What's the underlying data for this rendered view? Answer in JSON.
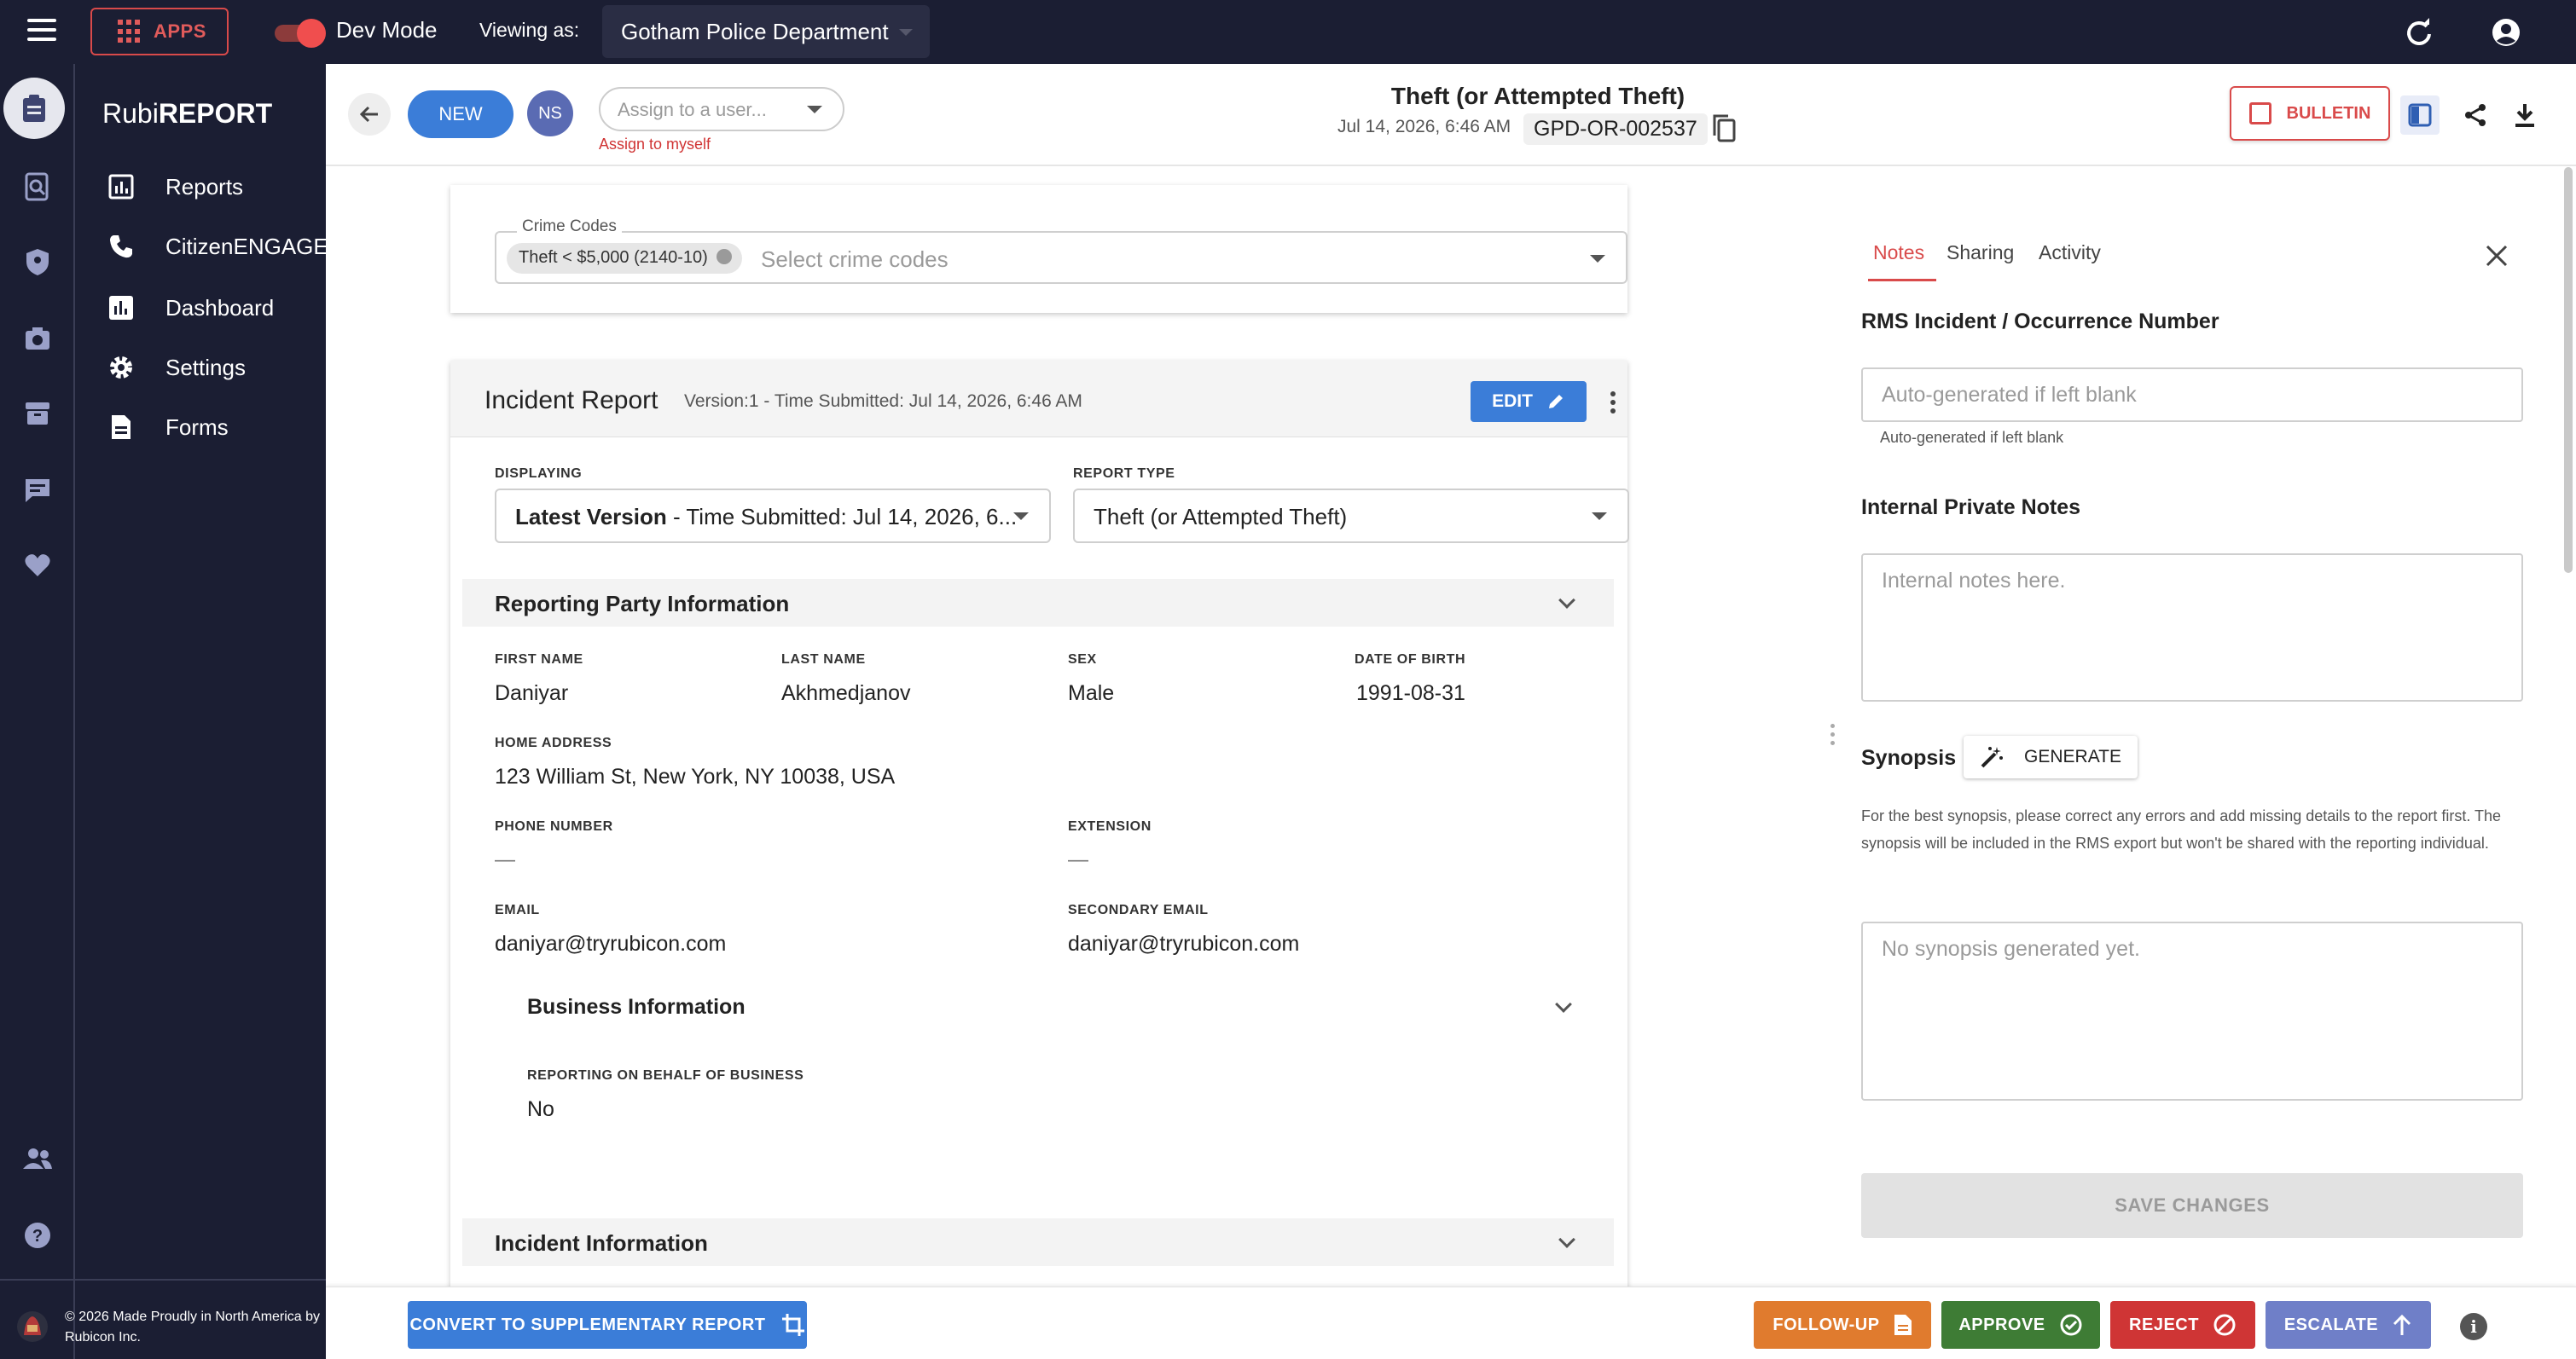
{
  "topbar": {
    "apps_label": "APPS",
    "dev_mode_label": "Dev Mode",
    "viewing_as_label": "Viewing as:",
    "department": "Gotham Police Department"
  },
  "brand": {
    "prefix": "Rubi",
    "suffix": "REPORT"
  },
  "nav": {
    "items": [
      {
        "label": "Reports",
        "icon": "reports-icon"
      },
      {
        "label": "CitizenENGAGE",
        "icon": "phone-icon"
      },
      {
        "label": "Dashboard",
        "icon": "dashboard-icon"
      },
      {
        "label": "Settings",
        "icon": "gear-icon"
      },
      {
        "label": "Forms",
        "icon": "document-icon"
      }
    ],
    "footer": "© 2026 Made Proudly in North America by Rubicon Inc."
  },
  "header": {
    "new_label": "NEW",
    "avatar_initials": "NS",
    "assign_placeholder": "Assign to a user...",
    "assign_to_myself": "Assign to myself",
    "title": "Theft (or Attempted Theft)",
    "datetime": "Jul 14, 2026, 6:46 AM",
    "report_id": "GPD-OR-002537",
    "bulletin_label": "BULLETIN"
  },
  "crime_codes": {
    "label": "Crime Codes",
    "chip": "Theft < $5,000 (2140-10)",
    "placeholder": "Select crime codes"
  },
  "incident_report": {
    "title": "Incident Report",
    "version": "Version:1 - Time Submitted: Jul 14, 2026, 6:46 AM",
    "edit_label": "EDIT",
    "displaying_label": "DISPLAYING",
    "displaying_bold": "Latest Version",
    "displaying_rest": " - Time Submitted: Jul 14, 2026, 6...",
    "report_type_label": "REPORT TYPE",
    "report_type_value": "Theft (or Attempted Theft)",
    "reporting_party": {
      "title": "Reporting Party Information",
      "first_name_label": "FIRST NAME",
      "first_name": "Daniyar",
      "last_name_label": "LAST NAME",
      "last_name": "Akhmedjanov",
      "sex_label": "SEX",
      "sex": "Male",
      "dob_label": "DATE OF BIRTH",
      "dob": "1991-08-31",
      "home_address_label": "HOME ADDRESS",
      "home_address": "123 William St, New York, NY 10038, USA",
      "phone_label": "PHONE NUMBER",
      "phone": "—",
      "extension_label": "EXTENSION",
      "extension": "—",
      "email_label": "EMAIL",
      "email": "daniyar@tryrubicon.com",
      "secondary_email_label": "SECONDARY EMAIL",
      "secondary_email": "daniyar@tryrubicon.com"
    },
    "business": {
      "title": "Business Information",
      "behalf_label": "REPORTING ON BEHALF OF BUSINESS",
      "behalf_value": "No"
    },
    "incident_info_title": "Incident Information"
  },
  "side_panel": {
    "tabs": [
      "Notes",
      "Sharing",
      "Activity"
    ],
    "rms_title": "RMS Incident / Occurrence Number",
    "rms_placeholder": "Auto-generated if left blank",
    "rms_helper": "Auto-generated if left blank",
    "notes_title": "Internal Private Notes",
    "notes_placeholder": "Internal notes here.",
    "synopsis_title": "Synopsis",
    "generate_label": "GENERATE",
    "synopsis_help": "For the best synopsis, please correct any errors and add missing details to the report first. The synopsis will be included in the RMS export but won't be shared with the reporting individual.",
    "synopsis_placeholder": "No synopsis generated yet.",
    "save_label": "SAVE CHANGES"
  },
  "actions": {
    "convert_label": "CONVERT TO SUPPLEMENTARY REPORT",
    "follow_up_label": "FOLLOW-UP",
    "approve_label": "APPROVE",
    "reject_label": "REJECT",
    "escalate_label": "ESCALATE"
  },
  "colors": {
    "sidebar_bg": "#1b1e33",
    "accent_red": "#d94a4a",
    "primary_blue": "#3b7dd8",
    "follow_up": "#e07b2e",
    "approve": "#3e7c35",
    "reject": "#cf3535",
    "escalate": "#6f7fc8"
  }
}
